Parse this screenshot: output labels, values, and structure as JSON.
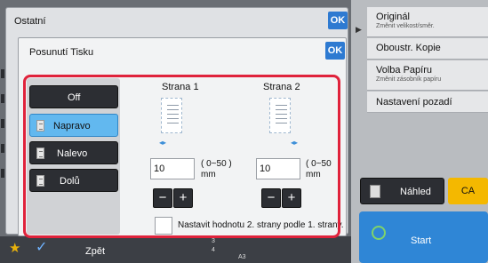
{
  "outer_dialog": {
    "title": "Ostatní",
    "ok_label": "OK"
  },
  "inner_dialog": {
    "title": "Posunutí Tisku",
    "ok_label": "OK"
  },
  "modes": [
    {
      "label": "Off",
      "selected": false
    },
    {
      "label": "Napravo",
      "selected": true
    },
    {
      "label": "Nalevo",
      "selected": false
    },
    {
      "label": "Dolů",
      "selected": false
    }
  ],
  "side1": {
    "heading": "Strana 1",
    "value": "10",
    "range": "( 0~50 )",
    "unit": "mm",
    "minus": "−",
    "plus": "+"
  },
  "side2": {
    "heading": "Strana 2",
    "value": "10",
    "range": "( 0~50",
    "unit": "mm",
    "minus": "−",
    "plus": "+"
  },
  "sync_checkbox": {
    "label": "Nastavit hodnotu 2. strany podle 1. strany.",
    "checked": false
  },
  "right_menu": [
    {
      "title": "Originál",
      "subtitle": "Změnit velikost/směr."
    },
    {
      "title": "Oboustr. Kopie",
      "subtitle": ""
    },
    {
      "title": "Volba Papíru",
      "subtitle": "Změnit zásobník papíru"
    },
    {
      "title": "Nastavení pozadí",
      "subtitle": ""
    }
  ],
  "actions": {
    "preview_label": "Náhled",
    "ca_label": "CA",
    "start_label": "Start"
  },
  "bottom_bar": {
    "back_label": "Zpět",
    "mini_status": [
      "3",
      "4",
      "A3"
    ]
  },
  "colors": {
    "accent_blue": "#2e7ad1",
    "highlight_red": "#e0223b",
    "selected_mode": "#62b8ef",
    "ca_yellow": "#f4b800",
    "start_blue": "#2f86d6"
  }
}
